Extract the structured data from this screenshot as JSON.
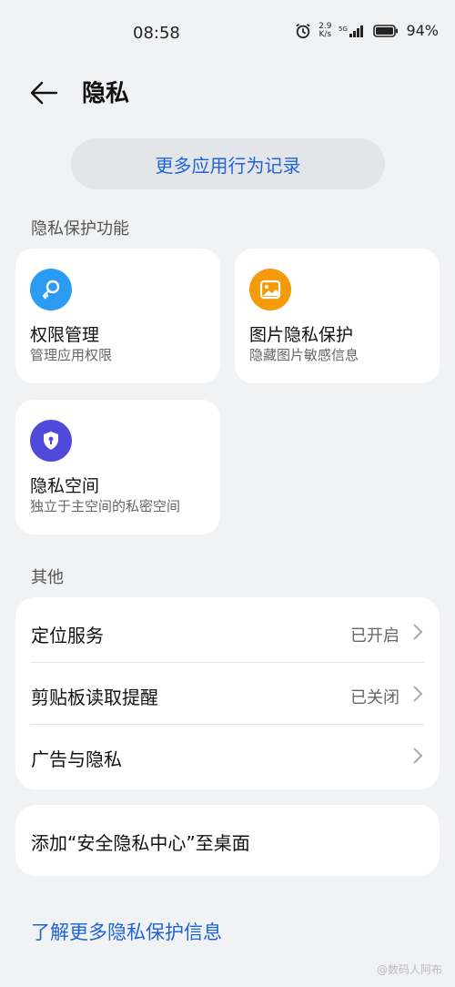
{
  "status_bar": {
    "time": "08:58",
    "net_speed_value": "2.9",
    "net_speed_unit": "K/s",
    "network_type": "5G",
    "battery": "94%"
  },
  "header": {
    "title": "隐私",
    "back_icon": "arrow-left-icon"
  },
  "more_records_label": "更多应用行为记录",
  "privacy_section": {
    "label": "隐私保护功能",
    "cards": [
      {
        "title": "权限管理",
        "subtitle": "管理应用权限",
        "icon": "key-icon",
        "color": "#2b9bf4"
      },
      {
        "title": "图片隐私保护",
        "subtitle": "隐藏图片敏感信息",
        "icon": "image-icon",
        "color": "#f59a0b"
      },
      {
        "title": "隐私空间",
        "subtitle": "独立于主空间的私密空间",
        "icon": "shield-lock-icon",
        "color": "#4f49d9"
      }
    ]
  },
  "other_section": {
    "label": "其他",
    "rows": [
      {
        "label": "定位服务",
        "value": "已开启"
      },
      {
        "label": "剪贴板读取提醒",
        "value": "已关闭"
      },
      {
        "label": "广告与隐私",
        "value": ""
      }
    ]
  },
  "shortcut_label": "添加“安全隐私中心”至桌面",
  "learn_more_label": "了解更多隐私保护信息",
  "watermark": "@数码人阿布",
  "colors": {
    "accent": "#1f64d6",
    "background": "#f1f2f4"
  }
}
